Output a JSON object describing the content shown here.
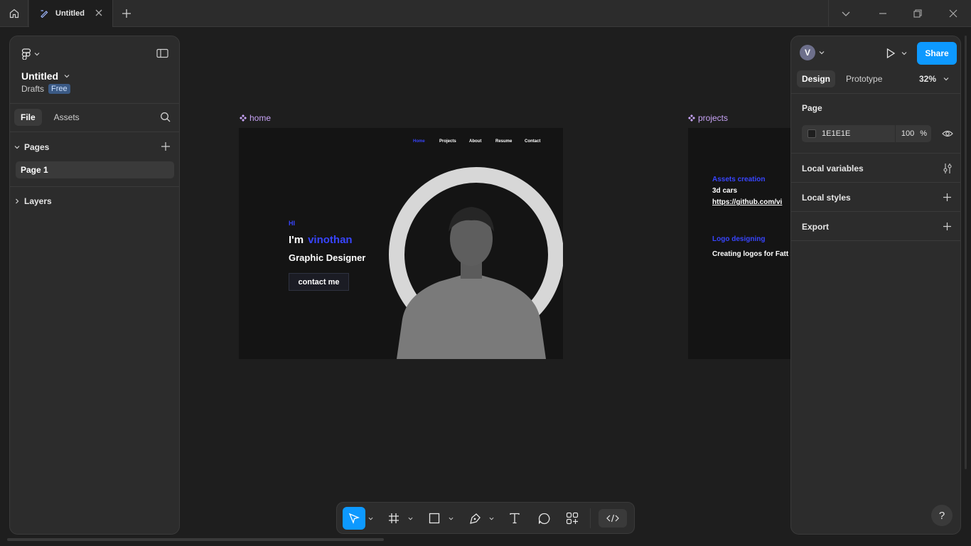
{
  "titlebar": {
    "tab_title": "Untitled"
  },
  "left_panel": {
    "file_title": "Untitled",
    "location": "Drafts",
    "plan_badge": "Free",
    "tabs": [
      "File",
      "Assets"
    ],
    "pages_header": "Pages",
    "pages": [
      "Page 1"
    ],
    "layers_header": "Layers"
  },
  "canvas": {
    "frames": [
      {
        "label": "home",
        "nav": [
          "Home",
          "Projects",
          "About",
          "Resume",
          "Contact"
        ],
        "hi": "HI",
        "im": "I'm",
        "name": "vinothan",
        "role": "Graphic Designer",
        "cta": "contact me"
      },
      {
        "label": "projects",
        "lines": [
          "Assets creation",
          "3d cars",
          "https://github.com/vi",
          "Logo designing",
          "Creating logos for Fatt"
        ]
      }
    ]
  },
  "right_panel": {
    "avatar_initial": "V",
    "share_label": "Share",
    "tabs": [
      "Design",
      "Prototype"
    ],
    "zoom": "32%",
    "page_section": "Page",
    "bg_color": "1E1E1E",
    "bg_opacity": "100",
    "percent": "%",
    "sections": [
      "Local variables",
      "Local styles",
      "Export"
    ]
  },
  "help": "?",
  "colors": {
    "accent": "#0d99ff",
    "frame_accent": "#3845ff",
    "frame_label": "#c7a3f5"
  }
}
